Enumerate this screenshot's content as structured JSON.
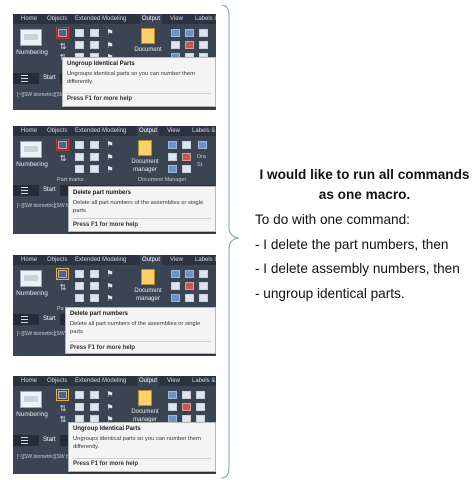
{
  "ribbon_tabs": [
    "Home",
    "Objects",
    "Extended Modeling",
    "Output",
    "View",
    "Labels &"
  ],
  "ribbon_tabs_short": [
    "Home",
    "Objects",
    "Extended Modeling",
    "Output",
    "View",
    "Labels & L"
  ],
  "numbering_label": "Numbering",
  "document_label": "Document",
  "document_manager_label": "Document manager",
  "document_manager_group": "Document Manager",
  "part_marks_label": "Part marks",
  "part_marks_short": "Pa",
  "drawing_short": "Dra",
  "drawing_short2": "St",
  "start_tab": "Start",
  "command_line": "[~][SW biometric][SW biometric]",
  "tooltips": {
    "ungroup_title": "Ungroup Identical Parts",
    "ungroup_body": "Ungroups identical parts so you can number them differently.",
    "delete_title": "Delete part numbers",
    "delete_body": "Delete all part numbers of the assemblies or single parts",
    "help": "Press F1 for more help"
  },
  "explanation": {
    "headline_line1": "I would like to run all commands",
    "headline_line2": "as one macro.",
    "intro": "To do with one command:",
    "step1": "- I delete the part numbers, then",
    "step2": "- I delete assembly numbers, then",
    "step3": "- ungroup identical parts."
  },
  "colors": {
    "ribbon_bg": "#3b4453",
    "highlight_red": "#d2342a",
    "highlight_yellow": "#e6b43d"
  }
}
